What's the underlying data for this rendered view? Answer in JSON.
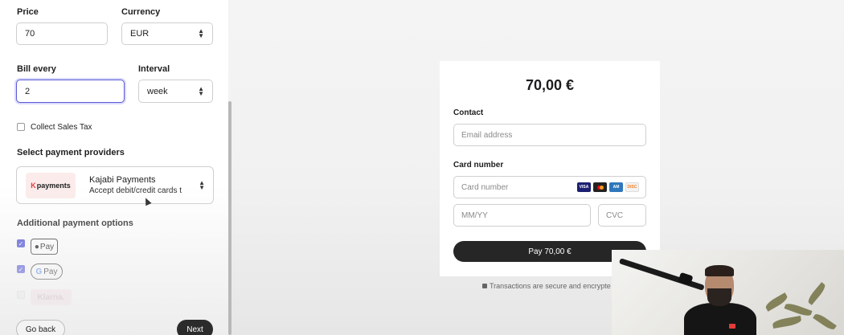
{
  "form": {
    "price_label": "Price",
    "price_value": "70",
    "currency_label": "Currency",
    "currency_value": "EUR",
    "bill_every_label": "Bill every",
    "bill_every_value": "2",
    "interval_label": "Interval",
    "interval_value": "week",
    "collect_tax_label": "Collect Sales Tax",
    "collect_tax_checked": false,
    "providers_heading": "Select payment providers",
    "provider": {
      "logo_text": "payments",
      "name": "Kajabi Payments",
      "description": "Accept debit/credit cards t"
    },
    "additional_heading": "Additional payment options",
    "options": [
      {
        "label": "Pay",
        "icon": "apple-icon",
        "checked": true
      },
      {
        "label": "Pay",
        "icon": "google-icon",
        "checked": true
      },
      {
        "label": "Klarna.",
        "checked": false
      }
    ],
    "go_back_label": "Go back",
    "next_label": "Next"
  },
  "checkout": {
    "amount": "70,00 €",
    "contact_label": "Contact",
    "email_placeholder": "Email address",
    "card_label": "Card number",
    "card_placeholder": "Card number",
    "expiry_placeholder": "MM/YY",
    "cvc_placeholder": "CVC",
    "card_brands": [
      "visa-icon",
      "mastercard-icon",
      "amex-icon",
      "discover-icon"
    ],
    "pay_button": "Pay 70,00 €",
    "secure_note": "Transactions are secure and encrypte"
  },
  "colors": {
    "accent": "#4b4fd8",
    "button_dark": "#262626",
    "kajabi_red": "#e23b3b"
  }
}
